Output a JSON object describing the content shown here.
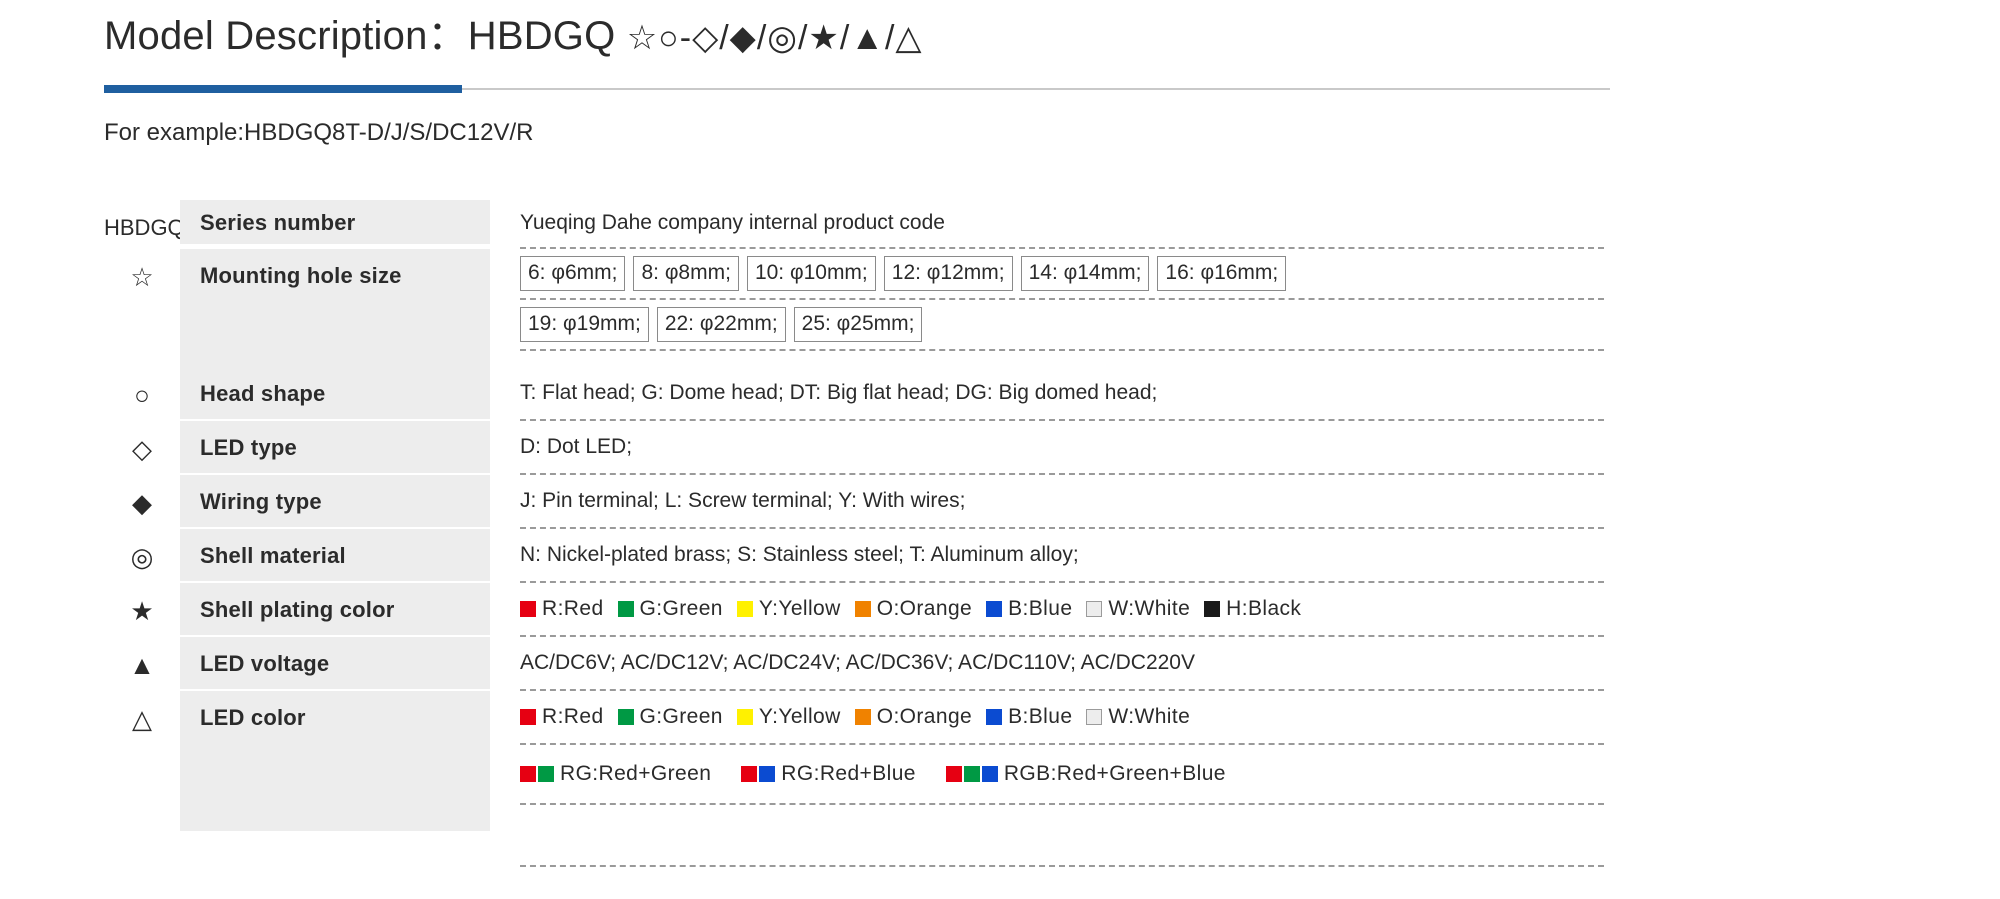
{
  "header": {
    "title_main": "Model Description：HBDGQ",
    "title_symbols": "☆○-◇/◆/◎/★/▲/△",
    "example": "For example:HBDGQ8T-D/J/S/DC12V/R",
    "accent_color": "#1f5fa0"
  },
  "palette": {
    "red": "#e60012",
    "green": "#009944",
    "yellow": "#fff100",
    "orange": "#f08200",
    "blue": "#0b4bd1",
    "white": "#ededed",
    "black": "#1a1a1a"
  },
  "table": {
    "rows": [
      {
        "symbol": "HBDGQ",
        "label": "Series number",
        "values": [
          "Yueqing Dahe company internal product code"
        ]
      },
      {
        "symbol": "☆",
        "label": "Mounting hole size",
        "boxes_line1": [
          "6: φ6mm;",
          "8: φ8mm;",
          "10: φ10mm;",
          "12: φ12mm;",
          "14: φ14mm;",
          "16: φ16mm;"
        ],
        "boxes_line2": [
          "19: φ19mm;",
          "22: φ22mm;",
          "25: φ25mm;"
        ]
      },
      {
        "symbol": "○",
        "label": "Head  shape",
        "values": [
          "T: Flat head;   G: Dome head;   DT: Big flat head;   DG: Big domed head;"
        ]
      },
      {
        "symbol": "◇",
        "label": "LED type",
        "values": [
          "D: Dot LED;"
        ]
      },
      {
        "symbol": "◆",
        "label": "Wiring type",
        "values": [
          "J: Pin terminal;   L: Screw terminal;   Y: With wires;"
        ]
      },
      {
        "symbol": "◎",
        "label": "Shell material",
        "values": [
          "N: Nickel-plated brass;   S: Stainless steel;   T: Aluminum alloy;"
        ]
      },
      {
        "symbol": "★",
        "label": "Shell plating color",
        "chips": [
          {
            "text": "R:Red",
            "color": "red"
          },
          {
            "text": "G:Green",
            "color": "green"
          },
          {
            "text": "Y:Yellow",
            "color": "yellow"
          },
          {
            "text": "O:Orange",
            "color": "orange"
          },
          {
            "text": "B:Blue",
            "color": "blue"
          },
          {
            "text": "W:White",
            "color": "white"
          },
          {
            "text": "H:Black",
            "color": "black"
          }
        ]
      },
      {
        "symbol": "▲",
        "label": "LED voltage",
        "values": [
          "AC/DC6V;   AC/DC12V;   AC/DC24V;   AC/DC36V;   AC/DC110V;   AC/DC220V"
        ]
      },
      {
        "symbol": "△",
        "label": "LED color",
        "chips": [
          {
            "text": "R:Red",
            "color": "red"
          },
          {
            "text": "G:Green",
            "color": "green"
          },
          {
            "text": "Y:Yellow",
            "color": "yellow"
          },
          {
            "text": "O:Orange",
            "color": "orange"
          },
          {
            "text": "B:Blue",
            "color": "blue"
          },
          {
            "text": "W:White",
            "color": "white"
          }
        ],
        "multi_chips": [
          {
            "text": "RG:Red+Green",
            "colors": [
              "red",
              "green"
            ]
          },
          {
            "text": "RG:Red+Blue",
            "colors": [
              "red",
              "blue"
            ]
          },
          {
            "text": "RGB:Red+Green+Blue",
            "colors": [
              "red",
              "green",
              "blue"
            ]
          }
        ]
      }
    ]
  }
}
